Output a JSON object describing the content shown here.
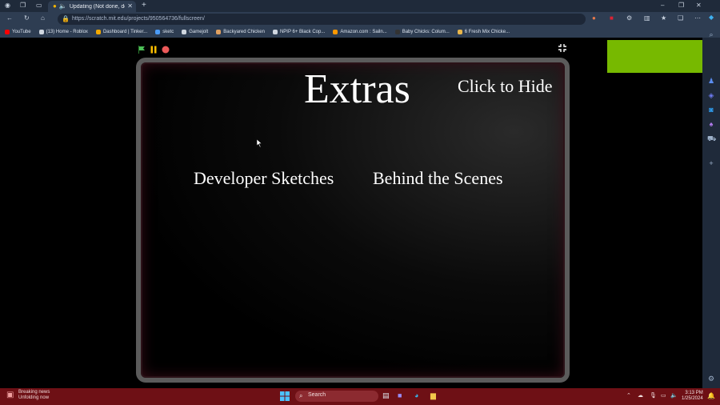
{
  "browser": {
    "tab_title": "Updating (Not done, dont p",
    "new_tab_symbol": "+",
    "url": "https://scratch.mit.edu/projects/950564736/fullscreen/",
    "bookmarks": [
      {
        "label": "YouTube",
        "color": "#ff0000"
      },
      {
        "label": "(13) Home - Roblox",
        "color": "#cfd6df"
      },
      {
        "label": "Dashboard | Tinker...",
        "color": "#f2a900"
      },
      {
        "label": "sketc",
        "color": "#4b9bf5"
      },
      {
        "label": "Gamejolt",
        "color": "#cfd6df"
      },
      {
        "label": "Backyared Chicken",
        "color": "#e0a060"
      },
      {
        "label": "NPIP 6+ Black Cop...",
        "color": "#cfd6df"
      },
      {
        "label": "Amazon.com : Sailn...",
        "color": "#ff9900"
      },
      {
        "label": "Baby Chicks: Colum...",
        "color": "#333333"
      },
      {
        "label": "6 Fresh Mix Chicke...",
        "color": "#e8b64a"
      }
    ]
  },
  "stage": {
    "title": "Extras",
    "hide_button": "Click to Hide",
    "option_1": "Developer Sketches",
    "option_2": "Behind the Scenes"
  },
  "taskbar": {
    "news_title": "Breaking news",
    "news_subtitle": "Unfolding now",
    "search_placeholder": "Search",
    "time": "3:13 PM",
    "date": "1/25/2024"
  },
  "colors": {
    "flag": "#4cbf56",
    "pause": "#ffbf00",
    "stop": "#ec5959",
    "accent_green": "#77b900"
  }
}
